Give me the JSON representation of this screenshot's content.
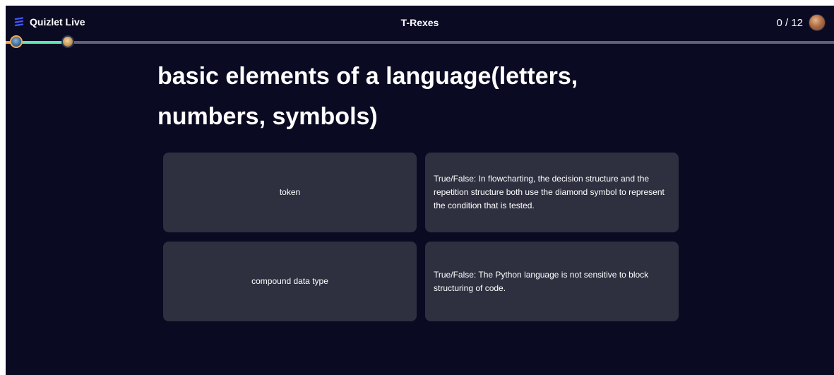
{
  "header": {
    "brand": "Quizlet Live",
    "brand_icon": "quizlet-stripes-icon",
    "team": "T-Rexes",
    "score": "0 / 12",
    "brand_color": "#4255ff"
  },
  "progress": {
    "correct": 0,
    "total": 12,
    "track_color": "#5e6278",
    "fill_color": "#59e6b0"
  },
  "question": {
    "prompt": "basic elements of a language(letters, numbers, symbols)"
  },
  "answers": [
    {
      "text": "token"
    },
    {
      "text": "True/False: In flowcharting, the decision structure and the repetition structure both use the diamond symbol to represent the condition that is tested."
    },
    {
      "text": "compound data type"
    },
    {
      "text": "True/False: The Python language is not sensitive to block structuring of code."
    }
  ]
}
